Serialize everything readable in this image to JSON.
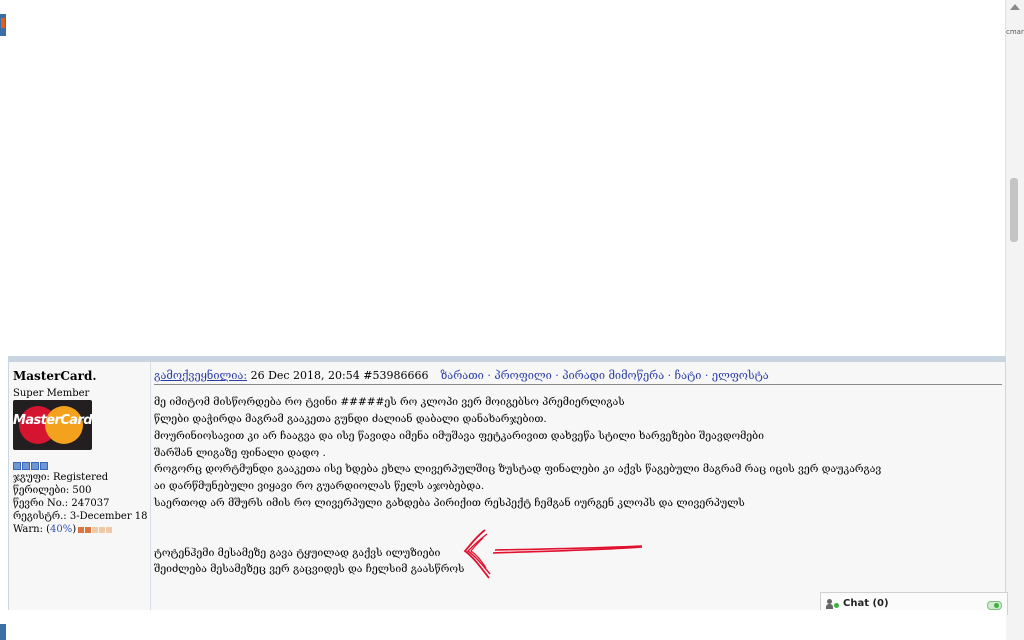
{
  "post": {
    "username": "MasterCard.",
    "user_title": "Super Member",
    "avatar_text": "MasterCard",
    "group": "ჯგუფი: Registered",
    "posts": "წერილები: 500",
    "member_no": "წევრი No.: 247037",
    "registered": "რეგისტრ.: 3-December 18",
    "warn_label": "Warn: (",
    "warn_pct": "40%",
    "warn_close": ")",
    "warn_level": 0.4,
    "posted_label": "გამოქვეყნილია:",
    "posted_date": " 26 Dec 2018, 20:54  #53986666",
    "links": "ზარათი · პროფილი · პირადი მიმოწერა · ჩატი · ელფოსტა",
    "lines": [
      "მე იმიტომ მისწორდება რო ტვინი #####ეს რო კლოპი ვერ მოიგებსო პრემიერლიგას",
      "წლები დაჭირდა მაგრამ გააკეთა გუნდი ძალიან დაბალი დანახარჯებით.",
      "მოურინიოსავით კი არ ჩააგვა და ისე წავიდა იმენა იმუშავა ფეტკარივით დახვეწა სტილი ხარვეზები შეავდომები",
      "შარშან ლიგაზე ფინალი დადო .",
      "როგორც დორტმუნდი გააკეთა ისე ხდება ეხლა ლივერპულშიც ზუსტად ფინალები კი აქვს წაგებული მაგრამ რაც იცის ვერ დაუკარგავ",
      "აი დარწმუნებული ვიყავი რო გუარდიოლას წელს აჯობებდა.",
      "საერთოდ არ მშურს იმის რო ლივერპული გახდება პირიქით რესპექტ ჩემგან იურგენ კლოპს და ლივერპულს",
      "ტოტენჰემი მესამეზე გავა ტყუილად გაქვს ილუზიები",
      "შეიძლება მესამეზეც ვერ გაცვიდეს და ჩელსიმ გაასწროს"
    ]
  },
  "chat": {
    "label": "Chat",
    "count": "(0)"
  },
  "scrollbar": {
    "label": "cmarks"
  },
  "colors": {
    "link": "#2a3ea8",
    "arrow": "#e0102e",
    "frame": "#c8d4e0",
    "warn": "#d9763f"
  }
}
